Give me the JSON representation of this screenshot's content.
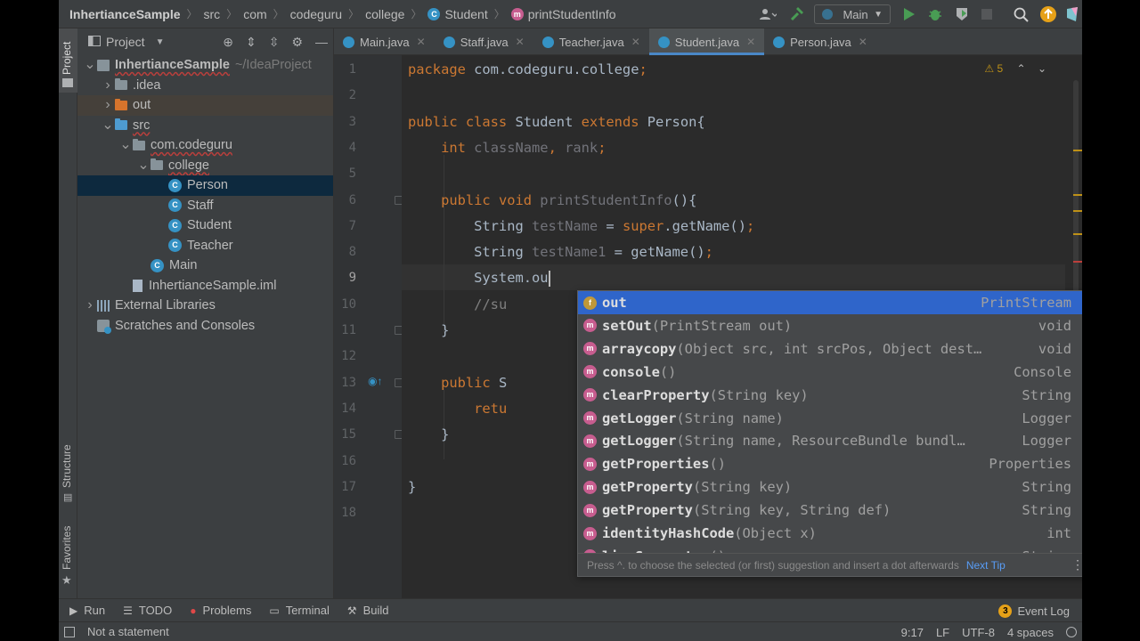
{
  "breadcrumb": {
    "project": "InhertianceSample",
    "path": [
      "src",
      "com",
      "codeguru",
      "college"
    ],
    "class": "Student",
    "method": "printStudentInfo"
  },
  "toolbar": {
    "run_config": "Main",
    "icons": [
      "user-icon",
      "hammer-icon",
      "run-icon",
      "debug-icon",
      "coverage-icon",
      "stop-icon",
      "search-icon",
      "update-icon",
      "jetbrains-icon"
    ]
  },
  "left_strip": {
    "project": "Project",
    "structure": "Structure",
    "favorites": "Favorites"
  },
  "project_panel": {
    "title": "Project",
    "tree": [
      {
        "label": "InhertianceSample",
        "suffix": "~/IdeaProject",
        "depth": 0,
        "expanded": true,
        "icon": "module"
      },
      {
        "label": ".idea",
        "depth": 1,
        "expanded": false,
        "icon": "folder-gray"
      },
      {
        "label": "out",
        "depth": 1,
        "expanded": false,
        "icon": "folder-orange"
      },
      {
        "label": "src",
        "depth": 1,
        "expanded": true,
        "icon": "folder-teal"
      },
      {
        "label": "com.codeguru",
        "depth": 2,
        "expanded": true,
        "icon": "folder-gray"
      },
      {
        "label": "college",
        "depth": 3,
        "expanded": true,
        "icon": "folder-gray"
      },
      {
        "label": "Person",
        "depth": 4,
        "icon": "class",
        "selected": true
      },
      {
        "label": "Staff",
        "depth": 4,
        "icon": "class"
      },
      {
        "label": "Student",
        "depth": 4,
        "icon": "class"
      },
      {
        "label": "Teacher",
        "depth": 4,
        "icon": "class"
      },
      {
        "label": "Main",
        "depth": 3,
        "icon": "class"
      },
      {
        "label": "InhertianceSample.iml",
        "depth": 2,
        "icon": "iml"
      },
      {
        "label": "External Libraries",
        "depth": 0,
        "expanded": false,
        "icon": "library"
      },
      {
        "label": "Scratches and Consoles",
        "depth": 0,
        "icon": "scratch"
      }
    ]
  },
  "tabs": [
    {
      "label": "Main.java",
      "icon": "class"
    },
    {
      "label": "Staff.java",
      "icon": "class"
    },
    {
      "label": "Teacher.java",
      "icon": "class"
    },
    {
      "label": "Student.java",
      "icon": "class",
      "active": true
    },
    {
      "label": "Person.java",
      "icon": "class"
    }
  ],
  "editor": {
    "warning_count": "5",
    "current_line": 9,
    "line_numbers": [
      "1",
      "2",
      "3",
      "4",
      "5",
      "6",
      "7",
      "8",
      "9",
      "10",
      "11",
      "12",
      "13",
      "14",
      "15",
      "16",
      "17",
      "18"
    ],
    "lines": [
      [
        {
          "t": "package ",
          "c": "kw"
        },
        {
          "t": "com.codeguru.college",
          "c": ""
        },
        {
          "t": ";",
          "c": "kw"
        }
      ],
      [],
      [
        {
          "t": "public class ",
          "c": "kw"
        },
        {
          "t": "Student ",
          "c": ""
        },
        {
          "t": "extends ",
          "c": "kw"
        },
        {
          "t": "Person{",
          "c": ""
        }
      ],
      [
        {
          "t": "    "
        },
        {
          "t": "int ",
          "c": "kw"
        },
        {
          "t": "className",
          "c": "unused"
        },
        {
          "t": ", ",
          "c": "kw"
        },
        {
          "t": "rank",
          "c": "unused"
        },
        {
          "t": ";",
          "c": "kw"
        }
      ],
      [],
      [
        {
          "t": "    "
        },
        {
          "t": "public void ",
          "c": "kw"
        },
        {
          "t": "printStudentInfo",
          "c": "unused"
        },
        {
          "t": "(){",
          "c": ""
        }
      ],
      [
        {
          "t": "        String "
        },
        {
          "t": "testName",
          "c": "unused"
        },
        {
          "t": " = "
        },
        {
          "t": "super",
          "c": "kw"
        },
        {
          "t": ".getName()"
        },
        {
          "t": ";",
          "c": "kw"
        }
      ],
      [
        {
          "t": "        String "
        },
        {
          "t": "testName1",
          "c": "unused"
        },
        {
          "t": " = getName()"
        },
        {
          "t": ";",
          "c": "kw"
        }
      ],
      [
        {
          "t": "        System.ou"
        }
      ],
      [
        {
          "t": "        "
        },
        {
          "t": "//su",
          "c": "cmt"
        }
      ],
      [
        {
          "t": "    }"
        }
      ],
      [],
      [
        {
          "t": "    "
        },
        {
          "t": "public ",
          "c": "kw"
        },
        {
          "t": "S"
        }
      ],
      [
        {
          "t": "        "
        },
        {
          "t": "retu",
          "c": "kw"
        }
      ],
      [
        {
          "t": "    }"
        }
      ],
      [],
      [
        {
          "t": "}"
        }
      ],
      []
    ]
  },
  "completion": {
    "items": [
      {
        "kind": "f",
        "name": "out",
        "sig": "",
        "ret": "PrintStream",
        "selected": true
      },
      {
        "kind": "m",
        "name": "setOut",
        "sig": "(PrintStream out)",
        "ret": "void"
      },
      {
        "kind": "m",
        "name": "arraycopy",
        "sig": "(Object src, int srcPos, Object dest…",
        "ret": "void"
      },
      {
        "kind": "m",
        "name": "console",
        "sig": "()",
        "ret": "Console"
      },
      {
        "kind": "m",
        "name": "clearProperty",
        "sig": "(String key)",
        "ret": "String"
      },
      {
        "kind": "m",
        "name": "getLogger",
        "sig": "(String name)",
        "ret": "Logger"
      },
      {
        "kind": "m",
        "name": "getLogger",
        "sig": "(String name, ResourceBundle bundl…",
        "ret": "Logger"
      },
      {
        "kind": "m",
        "name": "getProperties",
        "sig": "()",
        "ret": "Properties"
      },
      {
        "kind": "m",
        "name": "getProperty",
        "sig": "(String key)",
        "ret": "String"
      },
      {
        "kind": "m",
        "name": "getProperty",
        "sig": "(String key, String def)",
        "ret": "String"
      },
      {
        "kind": "m",
        "name": "identityHashCode",
        "sig": "(Object x)",
        "ret": "int"
      },
      {
        "kind": "m",
        "name": "lineSeparator",
        "sig": "()",
        "ret": "String"
      }
    ],
    "footer_hint": "Press ^. to choose the selected (or first) suggestion and insert a dot afterwards",
    "footer_link": "Next Tip"
  },
  "bottom_tools": [
    {
      "label": "Run",
      "icon": "run-icon"
    },
    {
      "label": "TODO",
      "icon": "todo-icon"
    },
    {
      "label": "Problems",
      "icon": "problems-icon"
    },
    {
      "label": "Terminal",
      "icon": "terminal-icon"
    },
    {
      "label": "Build",
      "icon": "build-icon"
    }
  ],
  "event_log": {
    "count": "3",
    "label": "Event Log"
  },
  "status": {
    "message": "Not a statement",
    "position": "9:17",
    "line_sep": "LF",
    "encoding": "UTF-8",
    "indent": "4 spaces"
  }
}
